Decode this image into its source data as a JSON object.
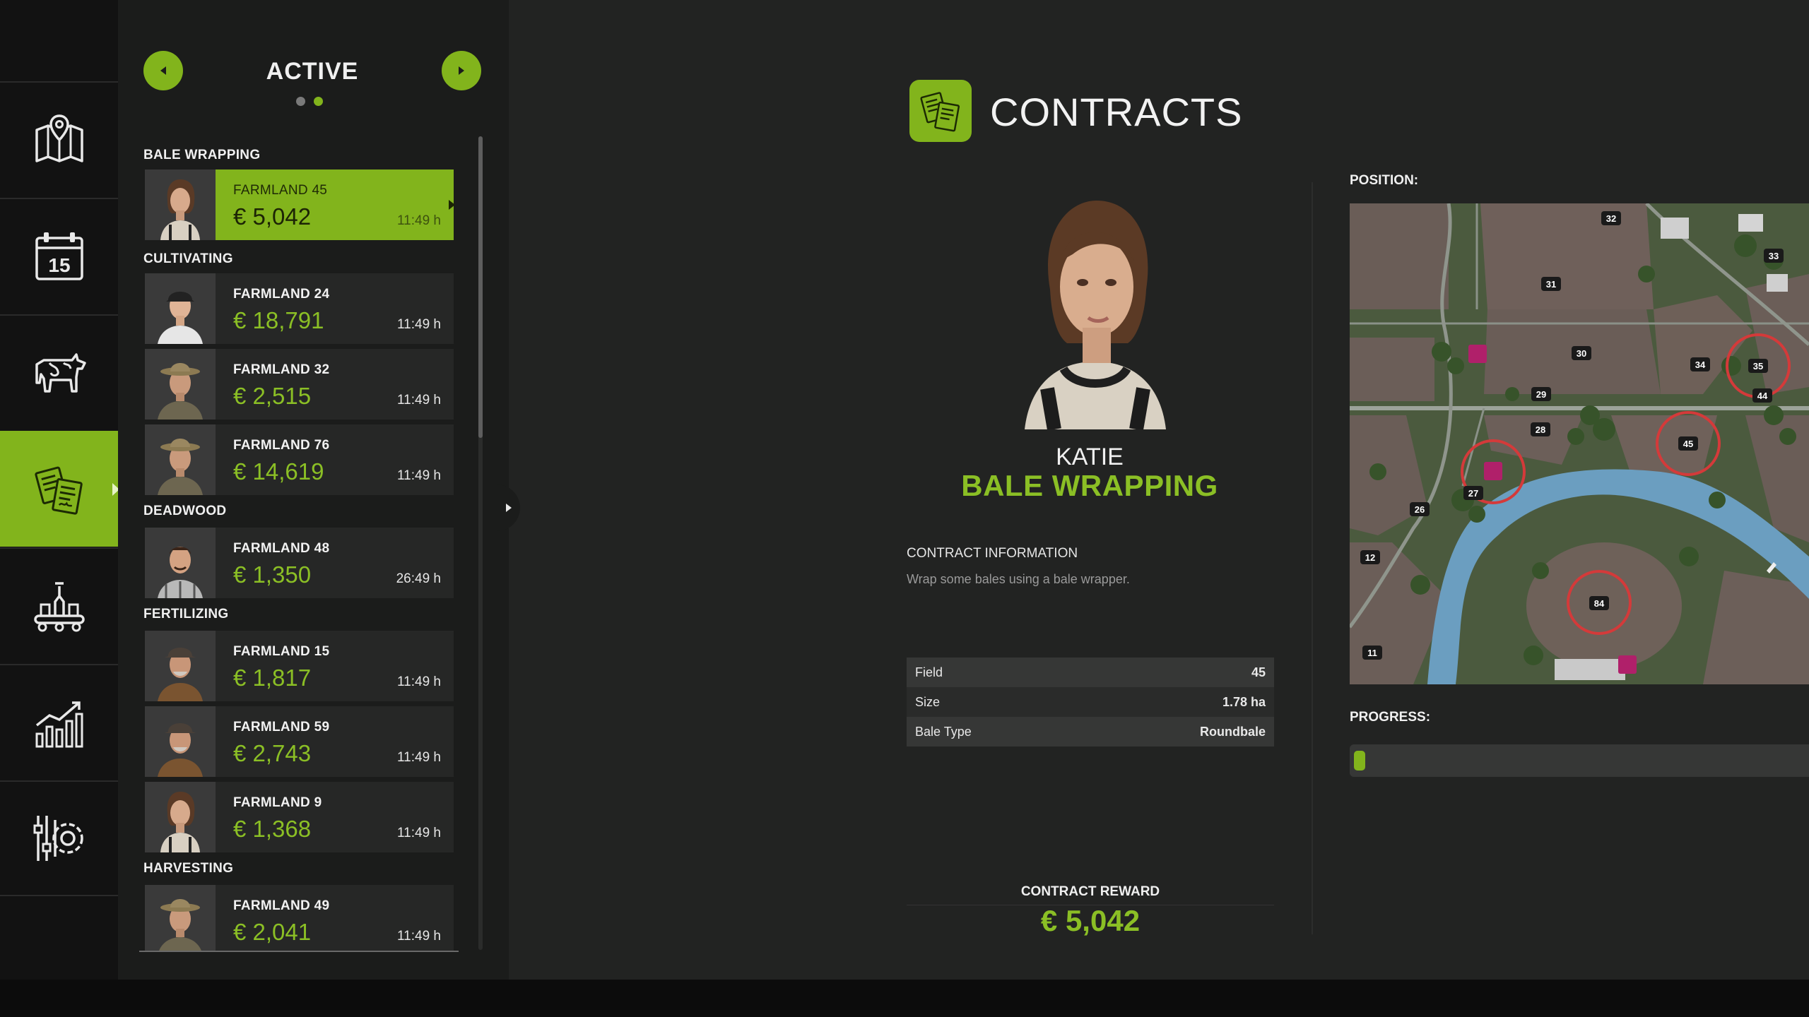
{
  "rail": {
    "items": [
      {
        "name": "map",
        "icon": "map-icon"
      },
      {
        "name": "calendar",
        "icon": "calendar-icon",
        "day": "15"
      },
      {
        "name": "animals",
        "icon": "cow-icon"
      },
      {
        "name": "contracts",
        "icon": "contracts-icon",
        "active": true
      },
      {
        "name": "production",
        "icon": "production-icon"
      },
      {
        "name": "statistics",
        "icon": "chart-icon"
      },
      {
        "name": "settings",
        "icon": "settings-icon"
      }
    ]
  },
  "list": {
    "title": "ACTIVE",
    "page_count": 2,
    "current_page": 2,
    "categories": [
      {
        "label": "BALE WRAPPING",
        "contracts": [
          {
            "farm": "FARMLAND 45",
            "price": "€ 5,042",
            "time": "11:49 h",
            "selected": true
          }
        ]
      },
      {
        "label": "CULTIVATING",
        "contracts": [
          {
            "farm": "FARMLAND 24",
            "price": "€ 18,791",
            "time": "11:49 h"
          },
          {
            "farm": "FARMLAND 32",
            "price": "€ 2,515",
            "time": "11:49 h"
          },
          {
            "farm": "FARMLAND 76",
            "price": "€ 14,619",
            "time": "11:49 h"
          }
        ]
      },
      {
        "label": "DEADWOOD",
        "contracts": [
          {
            "farm": "FARMLAND 48",
            "price": "€ 1,350",
            "time": "26:49 h"
          }
        ]
      },
      {
        "label": "FERTILIZING",
        "contracts": [
          {
            "farm": "FARMLAND 15",
            "price": "€ 1,817",
            "time": "11:49 h"
          },
          {
            "farm": "FARMLAND 59",
            "price": "€ 2,743",
            "time": "11:49 h"
          },
          {
            "farm": "FARMLAND 9",
            "price": "€ 1,368",
            "time": "11:49 h"
          }
        ]
      },
      {
        "label": "HARVESTING",
        "contracts": [
          {
            "farm": "FARMLAND 49",
            "price": "€ 2,041",
            "time": "11:49 h"
          }
        ]
      }
    ]
  },
  "detail": {
    "header": "CONTRACTS",
    "npc_name": "KATIE",
    "job": "BALE WRAPPING",
    "info_heading": "CONTRACT INFORMATION",
    "info_desc": "Wrap some bales using a bale wrapper.",
    "table": [
      {
        "label": "Field",
        "value": "45"
      },
      {
        "label": "Size",
        "value": "1.78 ha"
      },
      {
        "label": "Bale Type",
        "value": "Roundbale"
      }
    ],
    "reward_label": "CONTRACT REWARD",
    "reward_value": "€ 5,042"
  },
  "position": {
    "label": "POSITION:",
    "field_numbers": [
      "32",
      "33",
      "31",
      "30",
      "34",
      "35",
      "44",
      "29",
      "28",
      "45",
      "27",
      "26",
      "12",
      "84",
      "11"
    ],
    "highlighted_fields": [
      "35",
      "45",
      "27",
      "84"
    ]
  },
  "progress": {
    "label": "PROGRESS:",
    "value": 0.02
  },
  "colors": {
    "accent": "#82b41c",
    "price_green": "#8bbf25",
    "panel": "#1b1c1b",
    "background": "#222322"
  }
}
